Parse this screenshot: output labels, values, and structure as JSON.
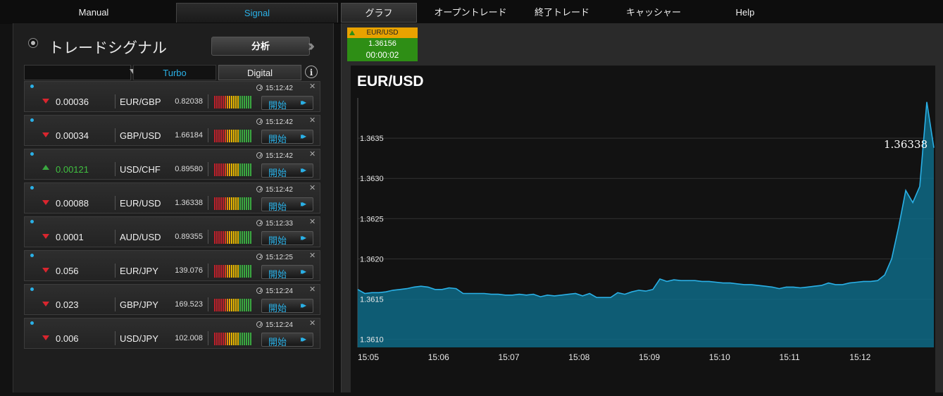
{
  "nav": {
    "manual": "Manual",
    "signal": "Signal",
    "graph": "グラフ",
    "open_trades": "オープントレード",
    "closed_trades": "終了トレード",
    "cashier": "キャッシャー",
    "help": "Help"
  },
  "signals_panel": {
    "title": "トレードシグナル",
    "analyze_button": "分析",
    "filter_selected": "",
    "tabs": [
      "Turbo",
      "Digital"
    ],
    "info_icon": "i",
    "start_label": "開始",
    "rows": [
      {
        "direction": "down",
        "value": "0.00036",
        "pair": "EUR/GBP",
        "price": "0.82038",
        "time": "15:12:42"
      },
      {
        "direction": "down",
        "value": "0.00034",
        "pair": "GBP/USD",
        "price": "1.66184",
        "time": "15:12:42"
      },
      {
        "direction": "up",
        "value": "0.00121",
        "pair": "USD/CHF",
        "price": "0.89580",
        "time": "15:12:42"
      },
      {
        "direction": "down",
        "value": "0.00088",
        "pair": "EUR/USD",
        "price": "1.36338",
        "time": "15:12:42"
      },
      {
        "direction": "down",
        "value": "0.0001",
        "pair": "AUD/USD",
        "price": "0.89355",
        "time": "15:12:33"
      },
      {
        "direction": "down",
        "value": "0.056",
        "pair": "EUR/JPY",
        "price": "139.076",
        "time": "15:12:25"
      },
      {
        "direction": "down",
        "value": "0.023",
        "pair": "GBP/JPY",
        "price": "169.523",
        "time": "15:12:24"
      },
      {
        "direction": "down",
        "value": "0.006",
        "pair": "USD/JPY",
        "price": "102.008",
        "time": "15:12:24"
      }
    ]
  },
  "quote": {
    "pair": "EUR/USD",
    "price": "1.36156",
    "countdown": "00:00:02"
  },
  "colors": {
    "accent": "#2ab0e6",
    "down": "#d9252e",
    "up": "#3aa840",
    "quote_header": "#e8a200",
    "quote_body": "#2e8e15",
    "meter": [
      "#c0202a",
      "#c0202a",
      "#c0202a",
      "#c0202a",
      "#c0202a",
      "#d04020",
      "#e08a10",
      "#e8a800",
      "#e8b800",
      "#e8b800",
      "#e8b800",
      "#e8b800",
      "#3aa840",
      "#3aa840",
      "#3aa840",
      "#3aa840",
      "#3aa840",
      "#3aa840"
    ]
  },
  "chart_data": {
    "type": "area",
    "title": "EUR/USD",
    "last_value_label": "1.36338",
    "xlabel": "",
    "ylabel": "",
    "x_ticks": [
      "15:05",
      "15:06",
      "15:07",
      "15:08",
      "15:09",
      "15:10",
      "15:11",
      "15:12"
    ],
    "y_ticks": [
      "1.3610",
      "1.3615",
      "1.3620",
      "1.3625",
      "1.3630",
      "1.3635"
    ],
    "ylim": [
      1.3609,
      1.364
    ],
    "xlim_minutes": [
      0,
      8.2
    ],
    "grid": true,
    "color": "#1a9fc4",
    "x_minutes": [
      0,
      0.1,
      0.2,
      0.3,
      0.4,
      0.5,
      0.6,
      0.7,
      0.8,
      0.9,
      1.0,
      1.1,
      1.2,
      1.3,
      1.4,
      1.5,
      1.6,
      1.7,
      1.8,
      1.9,
      2.0,
      2.1,
      2.2,
      2.3,
      2.4,
      2.5,
      2.6,
      2.7,
      2.8,
      2.9,
      3.0,
      3.1,
      3.2,
      3.3,
      3.4,
      3.5,
      3.6,
      3.7,
      3.8,
      3.9,
      4.0,
      4.1,
      4.2,
      4.3,
      4.4,
      4.5,
      4.6,
      4.7,
      4.8,
      4.9,
      5.0,
      5.1,
      5.2,
      5.3,
      5.4,
      5.5,
      5.6,
      5.7,
      5.8,
      5.9,
      6.0,
      6.1,
      6.2,
      6.3,
      6.4,
      6.5,
      6.6,
      6.7,
      6.8,
      6.9,
      7.0,
      7.1,
      7.2,
      7.3,
      7.4,
      7.5,
      7.6,
      7.7,
      7.8,
      7.9,
      8.0,
      8.1,
      8.2
    ],
    "values": [
      1.36162,
      1.36157,
      1.36158,
      1.36158,
      1.36159,
      1.36161,
      1.36162,
      1.36163,
      1.36165,
      1.36166,
      1.36165,
      1.36162,
      1.36162,
      1.36164,
      1.36163,
      1.36157,
      1.36157,
      1.36157,
      1.36157,
      1.36156,
      1.36156,
      1.36155,
      1.36155,
      1.36156,
      1.36155,
      1.36156,
      1.36153,
      1.36155,
      1.36154,
      1.36155,
      1.36156,
      1.36157,
      1.36154,
      1.36157,
      1.36152,
      1.36152,
      1.36152,
      1.36158,
      1.36156,
      1.36159,
      1.36161,
      1.3616,
      1.36162,
      1.36175,
      1.36172,
      1.36174,
      1.36173,
      1.36173,
      1.36173,
      1.36172,
      1.36172,
      1.36171,
      1.3617,
      1.3617,
      1.36169,
      1.36168,
      1.36168,
      1.36167,
      1.36166,
      1.36165,
      1.36163,
      1.36165,
      1.36165,
      1.36164,
      1.36165,
      1.36166,
      1.36167,
      1.3617,
      1.36168,
      1.36168,
      1.3617,
      1.36171,
      1.36172,
      1.36172,
      1.36173,
      1.3618,
      1.362,
      1.3624,
      1.36285,
      1.3627,
      1.3629,
      1.36395,
      1.36338
    ]
  }
}
